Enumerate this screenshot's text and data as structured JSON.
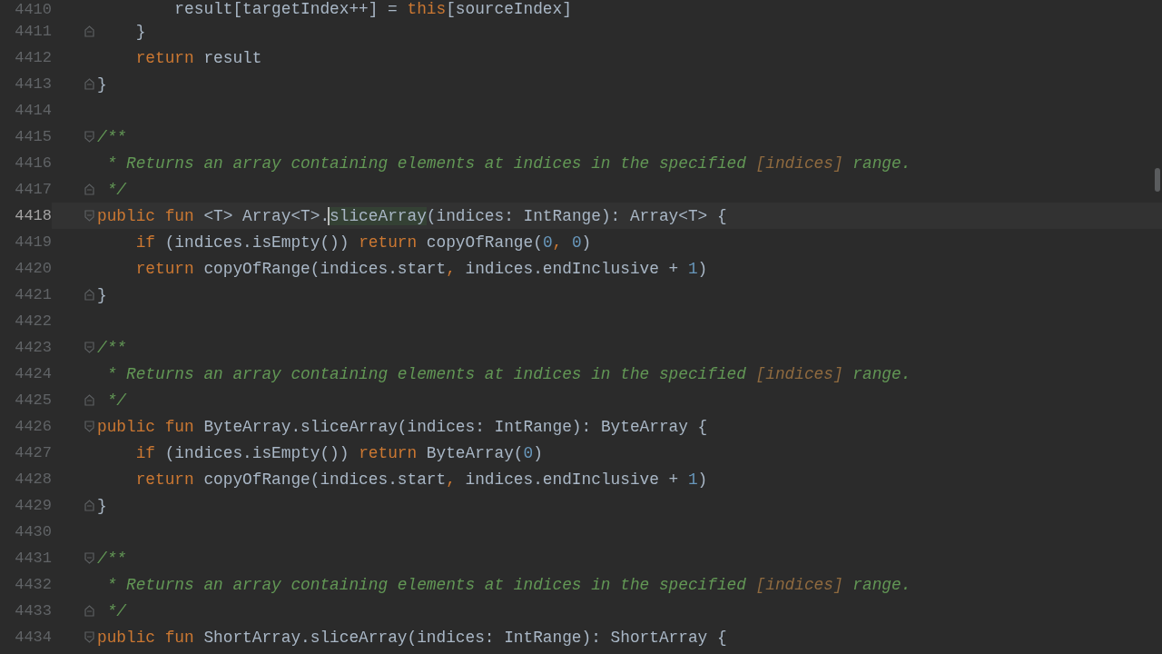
{
  "editor": {
    "lines": [
      {
        "number": "4410",
        "kind": "plain",
        "current": false,
        "tokens": [
          {
            "kind": "plain",
            "text": "        result[targetIndex++] = "
          },
          {
            "kind": "keyword",
            "text": "this"
          },
          {
            "kind": "plain",
            "text": "[sourceIndex]"
          }
        ]
      },
      {
        "number": "4411",
        "kind": "closer",
        "current": false,
        "tokens": [
          {
            "kind": "plain",
            "text": "    }"
          }
        ]
      },
      {
        "number": "4412",
        "kind": "plain",
        "current": false,
        "tokens": [
          {
            "kind": "keyword",
            "text": "    return"
          },
          {
            "kind": "plain",
            "text": " result"
          }
        ]
      },
      {
        "number": "4413",
        "kind": "closer",
        "current": false,
        "tokens": [
          {
            "kind": "plain",
            "text": "}"
          }
        ]
      },
      {
        "number": "4414",
        "kind": "plain",
        "current": false
      },
      {
        "number": "4415",
        "kind": "opener",
        "current": false,
        "tokens": [
          {
            "kind": "comment",
            "text": "/**"
          }
        ]
      },
      {
        "number": "4416",
        "kind": "plain",
        "current": false,
        "tokens": [
          {
            "kind": "comment",
            "text": " * Returns an array containing elements at indices in the specified "
          },
          {
            "kind": "reference",
            "text": "[indices]"
          },
          {
            "kind": "comment",
            "text": " range."
          }
        ]
      },
      {
        "number": "4417",
        "kind": "closer",
        "current": false,
        "tokens": [
          {
            "kind": "comment",
            "text": " */"
          }
        ]
      },
      {
        "number": "4418",
        "kind": "opener",
        "current": true,
        "tokens": [
          {
            "kind": "keyword",
            "text": "public"
          },
          {
            "kind": "keyword",
            "text": " fun"
          },
          {
            "kind": "plain",
            "text": " <T> Array<T>."
          },
          {
            "kind": "usage",
            "text": "sliceArray",
            "caret": true
          },
          {
            "kind": "plain",
            "text": "(indices: IntRange): Array<T> {"
          }
        ]
      },
      {
        "number": "4419",
        "kind": "plain",
        "current": false,
        "tokens": [
          {
            "kind": "keyword",
            "text": "    if"
          },
          {
            "kind": "plain",
            "text": " (indices.isEmpty()) "
          },
          {
            "kind": "keyword",
            "text": "return"
          },
          {
            "kind": "plain",
            "text": " copyOfRange("
          },
          {
            "kind": "number",
            "text": "0"
          },
          {
            "kind": "keyword",
            "text": ","
          },
          {
            "kind": "number",
            "text": " 0"
          },
          {
            "kind": "plain",
            "text": ")"
          }
        ]
      },
      {
        "number": "4420",
        "kind": "plain",
        "current": false,
        "tokens": [
          {
            "kind": "keyword",
            "text": "    return"
          },
          {
            "kind": "plain",
            "text": " copyOfRange(indices.start"
          },
          {
            "kind": "keyword",
            "text": ","
          },
          {
            "kind": "plain",
            "text": " indices.endInclusive + "
          },
          {
            "kind": "number",
            "text": "1"
          },
          {
            "kind": "plain",
            "text": ")"
          }
        ]
      },
      {
        "number": "4421",
        "kind": "closer",
        "current": false,
        "tokens": [
          {
            "kind": "plain",
            "text": "}"
          }
        ]
      },
      {
        "number": "4422",
        "kind": "plain",
        "current": false
      },
      {
        "number": "4423",
        "kind": "opener",
        "current": false,
        "tokens": [
          {
            "kind": "comment",
            "text": "/**"
          }
        ]
      },
      {
        "number": "4424",
        "kind": "plain",
        "current": false,
        "tokens": [
          {
            "kind": "comment",
            "text": " * Returns an array containing elements at indices in the specified "
          },
          {
            "kind": "reference",
            "text": "[indices]"
          },
          {
            "kind": "comment",
            "text": " range."
          }
        ]
      },
      {
        "number": "4425",
        "kind": "closer",
        "current": false,
        "tokens": [
          {
            "kind": "comment",
            "text": " */"
          }
        ]
      },
      {
        "number": "4426",
        "kind": "opener",
        "current": false,
        "tokens": [
          {
            "kind": "keyword",
            "text": "public"
          },
          {
            "kind": "keyword",
            "text": " fun"
          },
          {
            "kind": "plain",
            "text": " ByteArray.sliceArray(indices: IntRange): ByteArray {"
          }
        ]
      },
      {
        "number": "4427",
        "kind": "plain",
        "current": false,
        "tokens": [
          {
            "kind": "keyword",
            "text": "    if"
          },
          {
            "kind": "plain",
            "text": " (indices.isEmpty()) "
          },
          {
            "kind": "keyword",
            "text": "return"
          },
          {
            "kind": "plain",
            "text": " ByteArray("
          },
          {
            "kind": "number",
            "text": "0"
          },
          {
            "kind": "plain",
            "text": ")"
          }
        ]
      },
      {
        "number": "4428",
        "kind": "plain",
        "current": false,
        "tokens": [
          {
            "kind": "keyword",
            "text": "    return"
          },
          {
            "kind": "plain",
            "text": " copyOfRange(indices.start"
          },
          {
            "kind": "keyword",
            "text": ","
          },
          {
            "kind": "plain",
            "text": " indices.endInclusive + "
          },
          {
            "kind": "number",
            "text": "1"
          },
          {
            "kind": "plain",
            "text": ")"
          }
        ]
      },
      {
        "number": "4429",
        "kind": "closer",
        "current": false,
        "tokens": [
          {
            "kind": "plain",
            "text": "}"
          }
        ]
      },
      {
        "number": "4430",
        "kind": "plain",
        "current": false
      },
      {
        "number": "4431",
        "kind": "opener",
        "current": false,
        "tokens": [
          {
            "kind": "comment",
            "text": "/**"
          }
        ]
      },
      {
        "number": "4432",
        "kind": "plain",
        "current": false,
        "tokens": [
          {
            "kind": "comment",
            "text": " * Returns an array containing elements at indices in the specified "
          },
          {
            "kind": "reference",
            "text": "[indices]"
          },
          {
            "kind": "comment",
            "text": " range."
          }
        ]
      },
      {
        "number": "4433",
        "kind": "closer",
        "current": false,
        "tokens": [
          {
            "kind": "comment",
            "text": " */"
          }
        ]
      },
      {
        "number": "4434",
        "kind": "opener",
        "current": false,
        "tokens": [
          {
            "kind": "keyword",
            "text": "public"
          },
          {
            "kind": "keyword",
            "text": " fun"
          },
          {
            "kind": "plain",
            "text": " ShortArray.sliceArray(indices: IntRange): ShortArray {"
          }
        ]
      }
    ]
  }
}
